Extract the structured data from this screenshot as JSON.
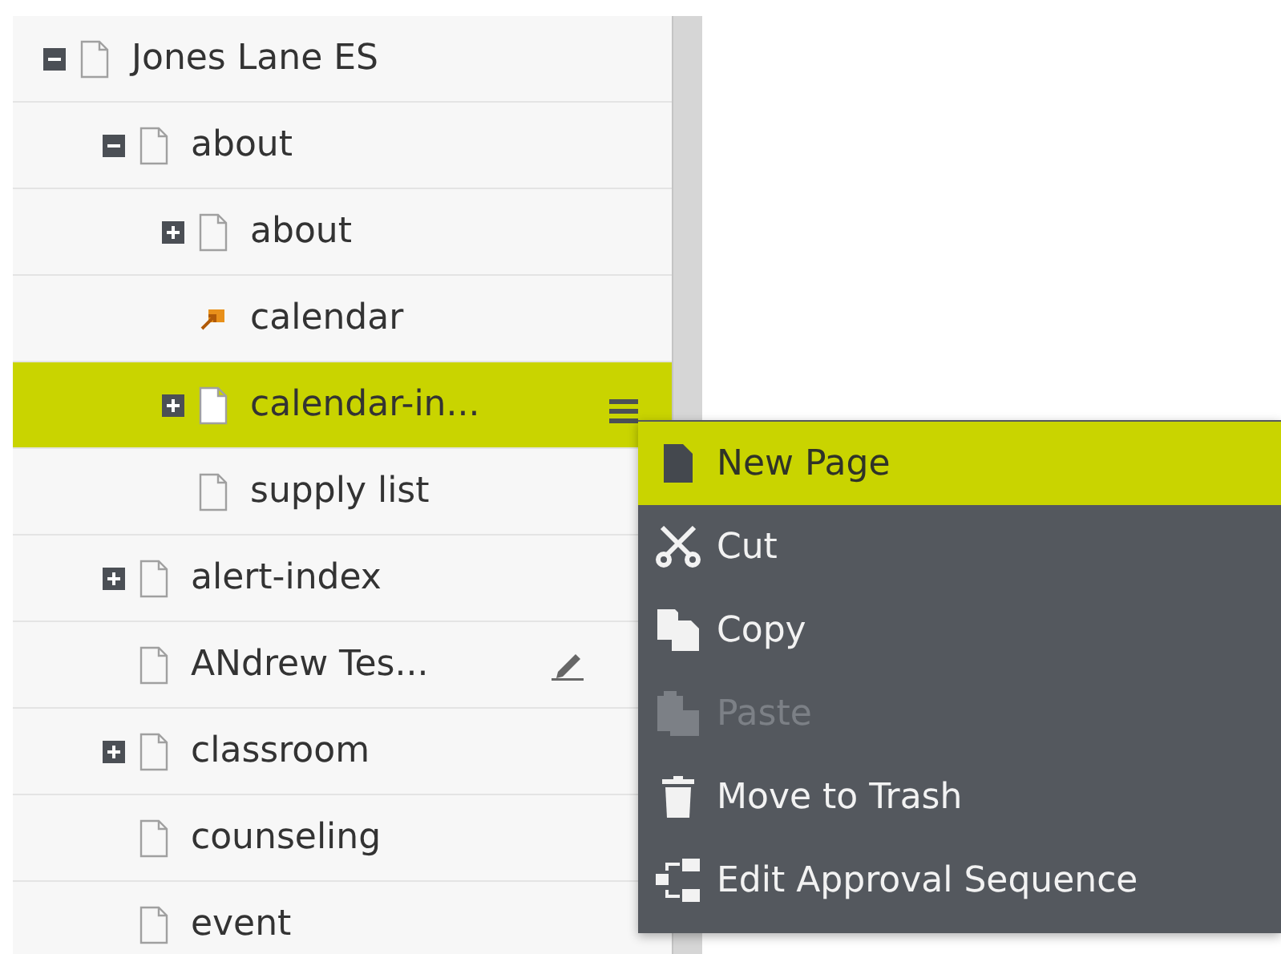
{
  "tree": [
    {
      "label": "Jones Lane ES",
      "kind": "page",
      "expanded": true,
      "selected": false,
      "editing": false,
      "children": [
        {
          "label": "about",
          "kind": "page",
          "expanded": true,
          "selected": false,
          "editing": false,
          "children": [
            {
              "label": "about",
              "kind": "page",
              "expanded": false,
              "selected": false,
              "editing": false
            },
            {
              "label": "calendar",
              "kind": "link",
              "selected": false,
              "editing": false
            },
            {
              "label": "calendar-in...",
              "kind": "page",
              "expanded": false,
              "selected": true,
              "editing": false
            },
            {
              "label": "supply list",
              "kind": "page",
              "selected": false,
              "editing": false
            }
          ]
        },
        {
          "label": "alert-index",
          "kind": "page",
          "expanded": false,
          "selected": false,
          "editing": false
        },
        {
          "label": "ANdrew Tes...",
          "kind": "page",
          "selected": false,
          "editing": true
        },
        {
          "label": "classroom",
          "kind": "page",
          "expanded": false,
          "selected": false,
          "editing": false
        },
        {
          "label": "counseling",
          "kind": "page",
          "selected": false,
          "editing": false
        },
        {
          "label": "event",
          "kind": "page",
          "selected": false,
          "editing": false
        }
      ]
    }
  ],
  "context_menu": [
    {
      "label": "New Page",
      "selected": true,
      "disabled": false
    },
    {
      "label": "Cut",
      "selected": false,
      "disabled": false
    },
    {
      "label": "Copy",
      "selected": false,
      "disabled": false
    },
    {
      "label": "Paste",
      "selected": false,
      "disabled": true
    },
    {
      "label": "Move to Trash",
      "selected": false,
      "disabled": false
    },
    {
      "label": "Edit Approval Sequence",
      "selected": false,
      "disabled": false
    }
  ]
}
